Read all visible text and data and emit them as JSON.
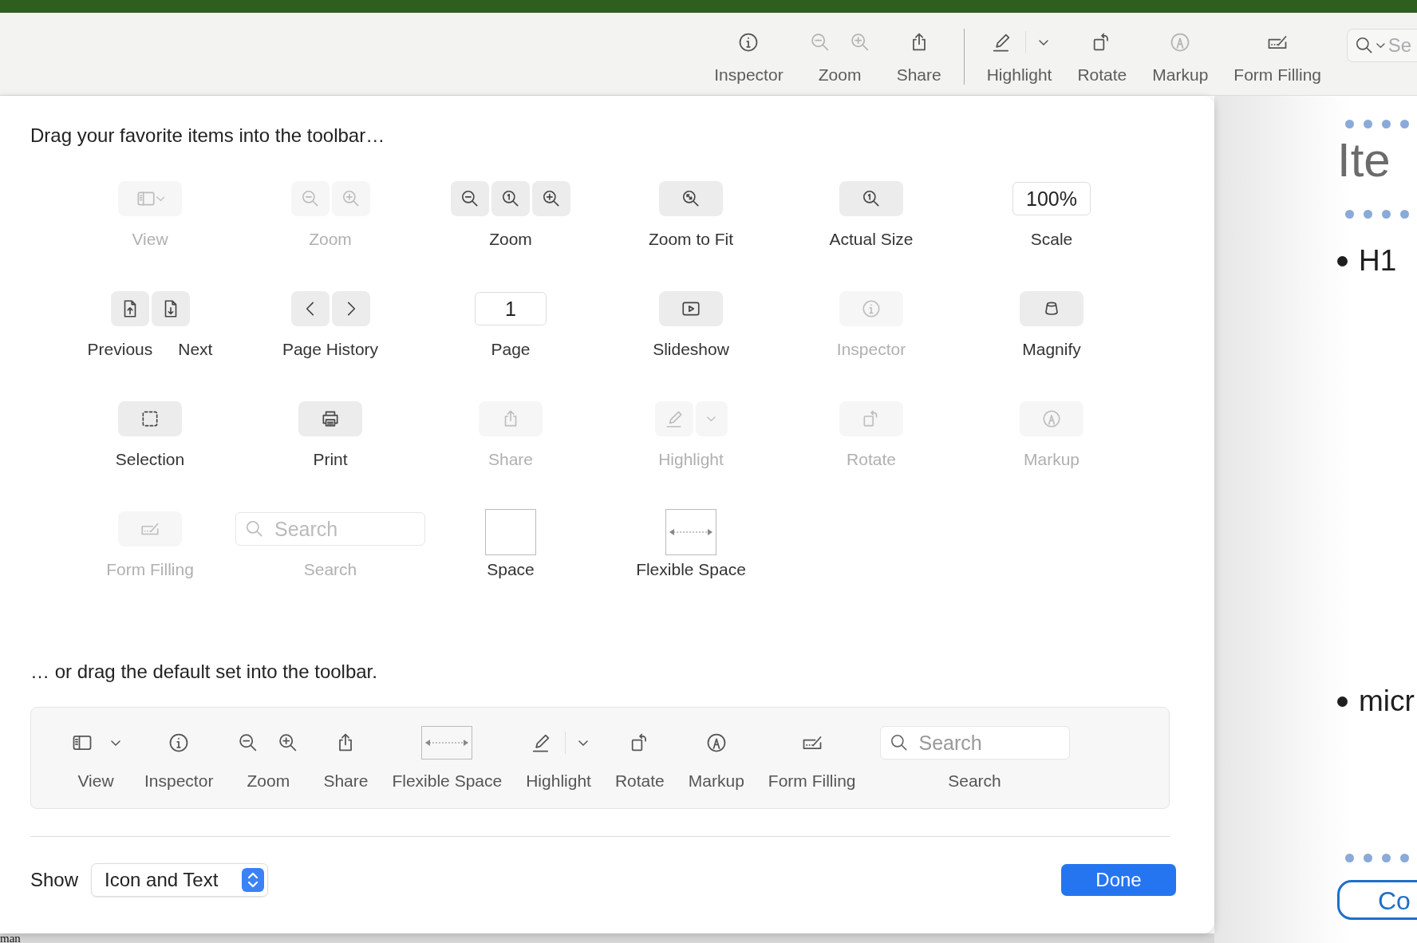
{
  "toolbar": {
    "items": [
      {
        "kind": "info",
        "label": "Inspector",
        "disabled": false
      },
      {
        "kind": "zoompair",
        "label": "Zoom",
        "disabled": true
      },
      {
        "kind": "share",
        "label": "Share",
        "disabled": false
      },
      {
        "kind": "separator"
      },
      {
        "kind": "highlight",
        "label": "Highlight",
        "disabled": false
      },
      {
        "kind": "rotate",
        "label": "Rotate",
        "disabled": false
      },
      {
        "kind": "markup",
        "label": "Markup",
        "disabled": true
      },
      {
        "kind": "form",
        "label": "Form Filling",
        "disabled": false
      },
      {
        "kind": "search",
        "placeholder": "Se"
      }
    ]
  },
  "sheet": {
    "title": "Drag your favorite items into the toolbar…",
    "palette": [
      {
        "kind": "view",
        "label": "View",
        "disabled": true
      },
      {
        "kind": "zoompair",
        "label": "Zoom",
        "disabled": true
      },
      {
        "kind": "zoomtrio",
        "label": "Zoom",
        "disabled": false
      },
      {
        "kind": "zoomfit",
        "label": "Zoom to Fit",
        "disabled": false
      },
      {
        "kind": "actualsize",
        "label": "Actual Size",
        "disabled": false
      },
      {
        "kind": "scalefield",
        "value": "100%",
        "label": "Scale",
        "disabled": false
      },
      {
        "kind": "prevnext",
        "labels": [
          "Previous",
          "Next"
        ],
        "disabled": false
      },
      {
        "kind": "history",
        "label": "Page History",
        "disabled": false
      },
      {
        "kind": "pagefield",
        "value": "1",
        "label": "Page",
        "disabled": false
      },
      {
        "kind": "slideshow",
        "label": "Slideshow",
        "disabled": false
      },
      {
        "kind": "info",
        "label": "Inspector",
        "disabled": true
      },
      {
        "kind": "magnify",
        "label": "Magnify",
        "disabled": false
      },
      {
        "kind": "selection",
        "label": "Selection",
        "disabled": false
      },
      {
        "kind": "print",
        "label": "Print",
        "disabled": false
      },
      {
        "kind": "share",
        "label": "Share",
        "disabled": true
      },
      {
        "kind": "highlight",
        "label": "Highlight",
        "disabled": true
      },
      {
        "kind": "rotate",
        "label": "Rotate",
        "disabled": true
      },
      {
        "kind": "markup",
        "label": "Markup",
        "disabled": true
      },
      {
        "kind": "form",
        "label": "Form Filling",
        "disabled": true
      },
      {
        "kind": "search",
        "placeholder": "Search",
        "label": "Search",
        "disabled": true
      },
      {
        "kind": "space",
        "label": "Space",
        "disabled": false
      },
      {
        "kind": "flexspace",
        "label": "Flexible Space",
        "disabled": false
      }
    ],
    "default_title": "… or drag the default set into the toolbar.",
    "default_set": [
      {
        "kind": "view",
        "label": "View"
      },
      {
        "kind": "info",
        "label": "Inspector"
      },
      {
        "kind": "zoompair",
        "label": "Zoom"
      },
      {
        "kind": "share",
        "label": "Share"
      },
      {
        "kind": "flexspace",
        "label": "Flexible Space"
      },
      {
        "kind": "highlight",
        "label": "Highlight"
      },
      {
        "kind": "rotate",
        "label": "Rotate"
      },
      {
        "kind": "markup",
        "label": "Markup"
      },
      {
        "kind": "form",
        "label": "Form Filling"
      },
      {
        "kind": "search",
        "placeholder": "Search",
        "label": "Search"
      }
    ],
    "show_label": "Show",
    "show_value": "Icon and Text",
    "done": "Done"
  },
  "document": {
    "heading": "Ite",
    "bullets": [
      "H1",
      "micr"
    ],
    "button": "Co"
  },
  "behind_sheet": {
    "text": "man"
  }
}
